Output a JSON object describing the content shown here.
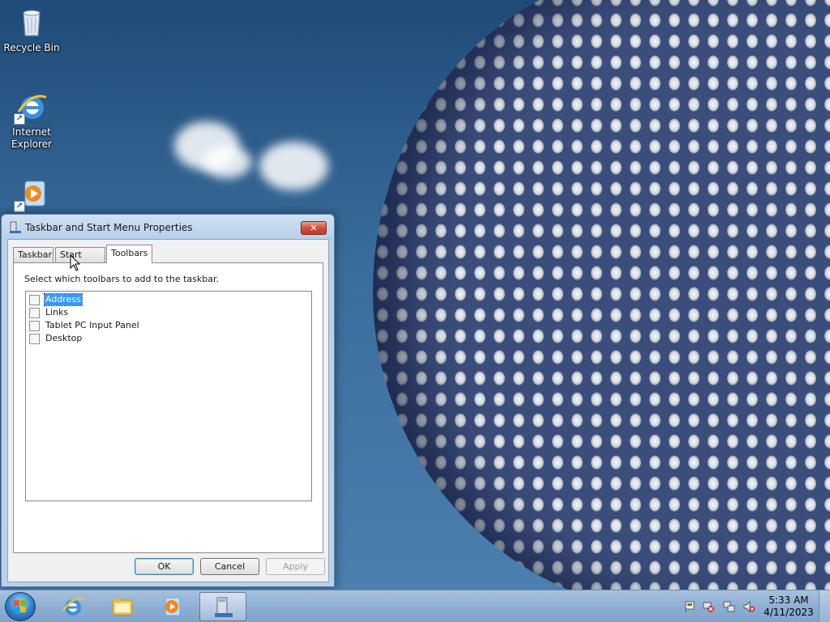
{
  "desktop": {
    "icons": [
      {
        "label": "Recycle Bin",
        "icon": "recycle-bin-icon"
      },
      {
        "label": "Internet\nExplorer",
        "icon": "internet-explorer-icon"
      },
      {
        "label": "",
        "icon": "media-player-icon"
      }
    ]
  },
  "dialog": {
    "title": "Taskbar and Start Menu Properties",
    "close_label": "✕",
    "tabs": [
      {
        "label": "Taskbar"
      },
      {
        "label": "Start Menu"
      },
      {
        "label": "Toolbars",
        "active": true
      }
    ],
    "instructions": "Select which toolbars to add to the taskbar.",
    "toolbars": [
      {
        "label": "Address",
        "checked": false,
        "selected": true
      },
      {
        "label": "Links",
        "checked": false
      },
      {
        "label": "Tablet PC Input Panel",
        "checked": false
      },
      {
        "label": "Desktop",
        "checked": false
      }
    ],
    "buttons": {
      "ok": "OK",
      "cancel": "Cancel",
      "apply": "Apply"
    }
  },
  "taskbar": {
    "clock": {
      "time": "5:33 AM",
      "date": "4/11/2023"
    }
  },
  "colors": {
    "selection": "#3399ff",
    "taskbar": "#8fb0d3",
    "close_button": "#c0392b"
  }
}
